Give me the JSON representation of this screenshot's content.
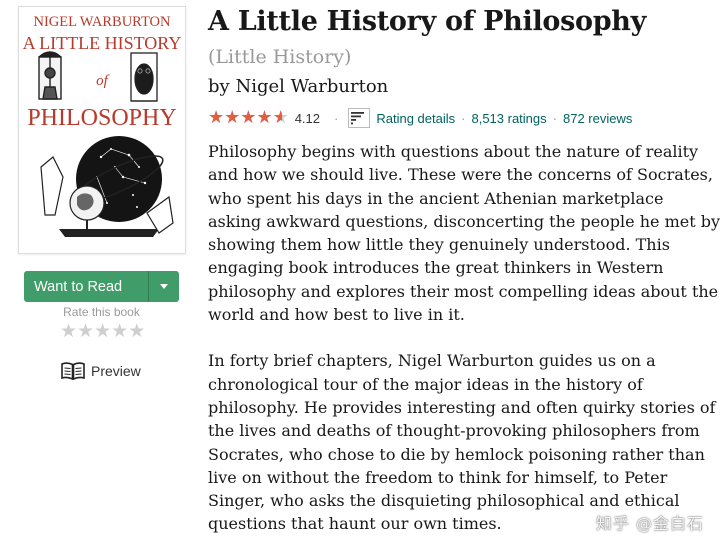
{
  "book": {
    "cover_author": "NIGEL WARBURTON",
    "cover_title_line1": "A LITTLE HISTORY",
    "cover_title_of": "of",
    "cover_title_line2": "PHILOSOPHY",
    "title": "A Little History of Philosophy",
    "series": "(Little History)",
    "by_label": "by",
    "author": "Nigel Warburton"
  },
  "actions": {
    "want_to_read": "Want to Read",
    "rate_label": "Rate this book",
    "preview": "Preview"
  },
  "rating": {
    "stars": [
      "★",
      "★",
      "★",
      "★",
      "★"
    ],
    "empty_stars": [
      "★",
      "★",
      "★",
      "★",
      "★"
    ],
    "value": 4.12,
    "average_text": "4.12",
    "separator": "·",
    "details_label": "Rating details",
    "ratings_count": "8,513 ratings",
    "reviews_count": "872 reviews",
    "star_color": "#e05f44",
    "link_color": "#00635d"
  },
  "description": [
    "Philosophy begins with questions about the nature of reality and how we should live. These were the concerns of Socrates, who spent his days in the ancient Athenian marketplace asking awkward questions, disconcerting the people he met by showing them how little they genuinely understood. This engaging book introduces the great thinkers in Western philosophy and explores their most compelling ideas about the world and how best to live in it.",
    "In forty brief chapters, Nigel Warburton guides us on a chronological tour of the major ideas in the history of philosophy. He provides interesting and often quirky stories of the lives and deaths of thought-provoking philosophers from Socrates, who chose to die by hemlock poisoning rather than live on without the freedom to think for himself, to Peter Singer, who asks the disquieting philosophical and ethical questions that haunt our own times."
  ],
  "watermark": "知乎 @金白石",
  "colors": {
    "accent_green": "#409d69",
    "cover_red": "#c0392b"
  }
}
